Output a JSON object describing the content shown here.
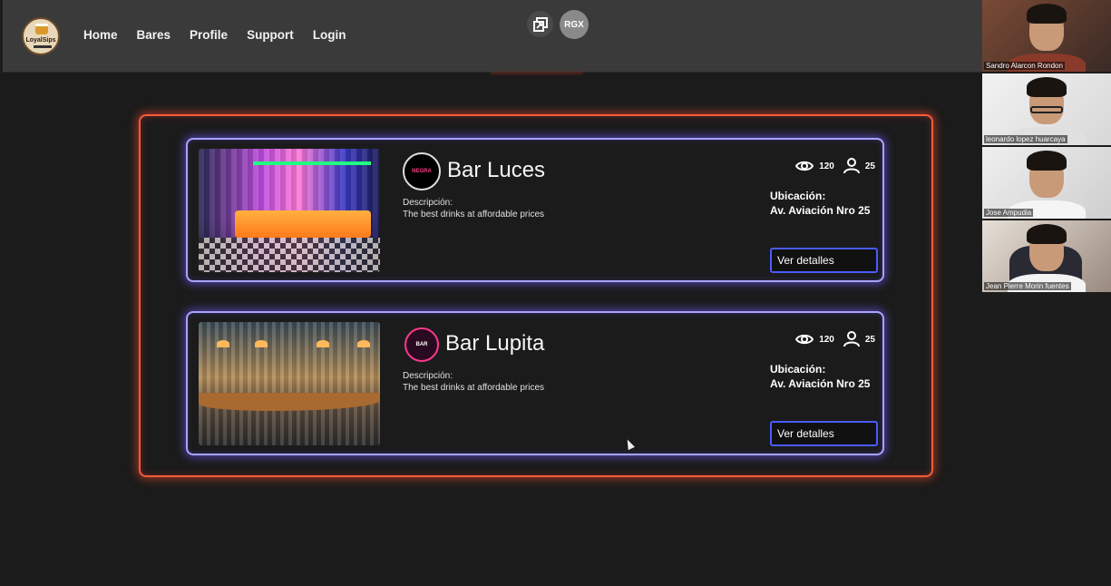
{
  "navbar": {
    "logo_text": "LoyalSips",
    "links": [
      "Home",
      "Bares",
      "Profile",
      "Support",
      "Login"
    ],
    "avatar_initials": "RGX"
  },
  "bars": [
    {
      "name": "Bar Luces",
      "logo_text": "NEGRA",
      "description_label": "Descripción:",
      "description": "The best drinks at affordable prices",
      "views": "120",
      "users": "25",
      "location_label": "Ubicación:",
      "location": "Av. Aviación Nro 25",
      "details_label": "Ver detalles"
    },
    {
      "name": "Bar Lupita",
      "logo_text": "BAR",
      "description_label": "Descripción:",
      "description": "The best drinks at affordable prices",
      "views": "120",
      "users": "25",
      "location_label": "Ubicación:",
      "location": "Av. Aviación Nro 25",
      "details_label": "Ver detalles"
    }
  ],
  "participants": [
    "Sandro Alarcon Rondon",
    "leonardo lopez huarcaya",
    "Jose Ampudia",
    "Jean Pierre Morin fuentes"
  ],
  "colors": {
    "outer_neon": "#ff5a3c",
    "card_neon": "#a9a3ff",
    "button_border": "#4a5cff",
    "navbar_bg": "#3a3a3a",
    "page_bg": "#1b1b1b"
  }
}
